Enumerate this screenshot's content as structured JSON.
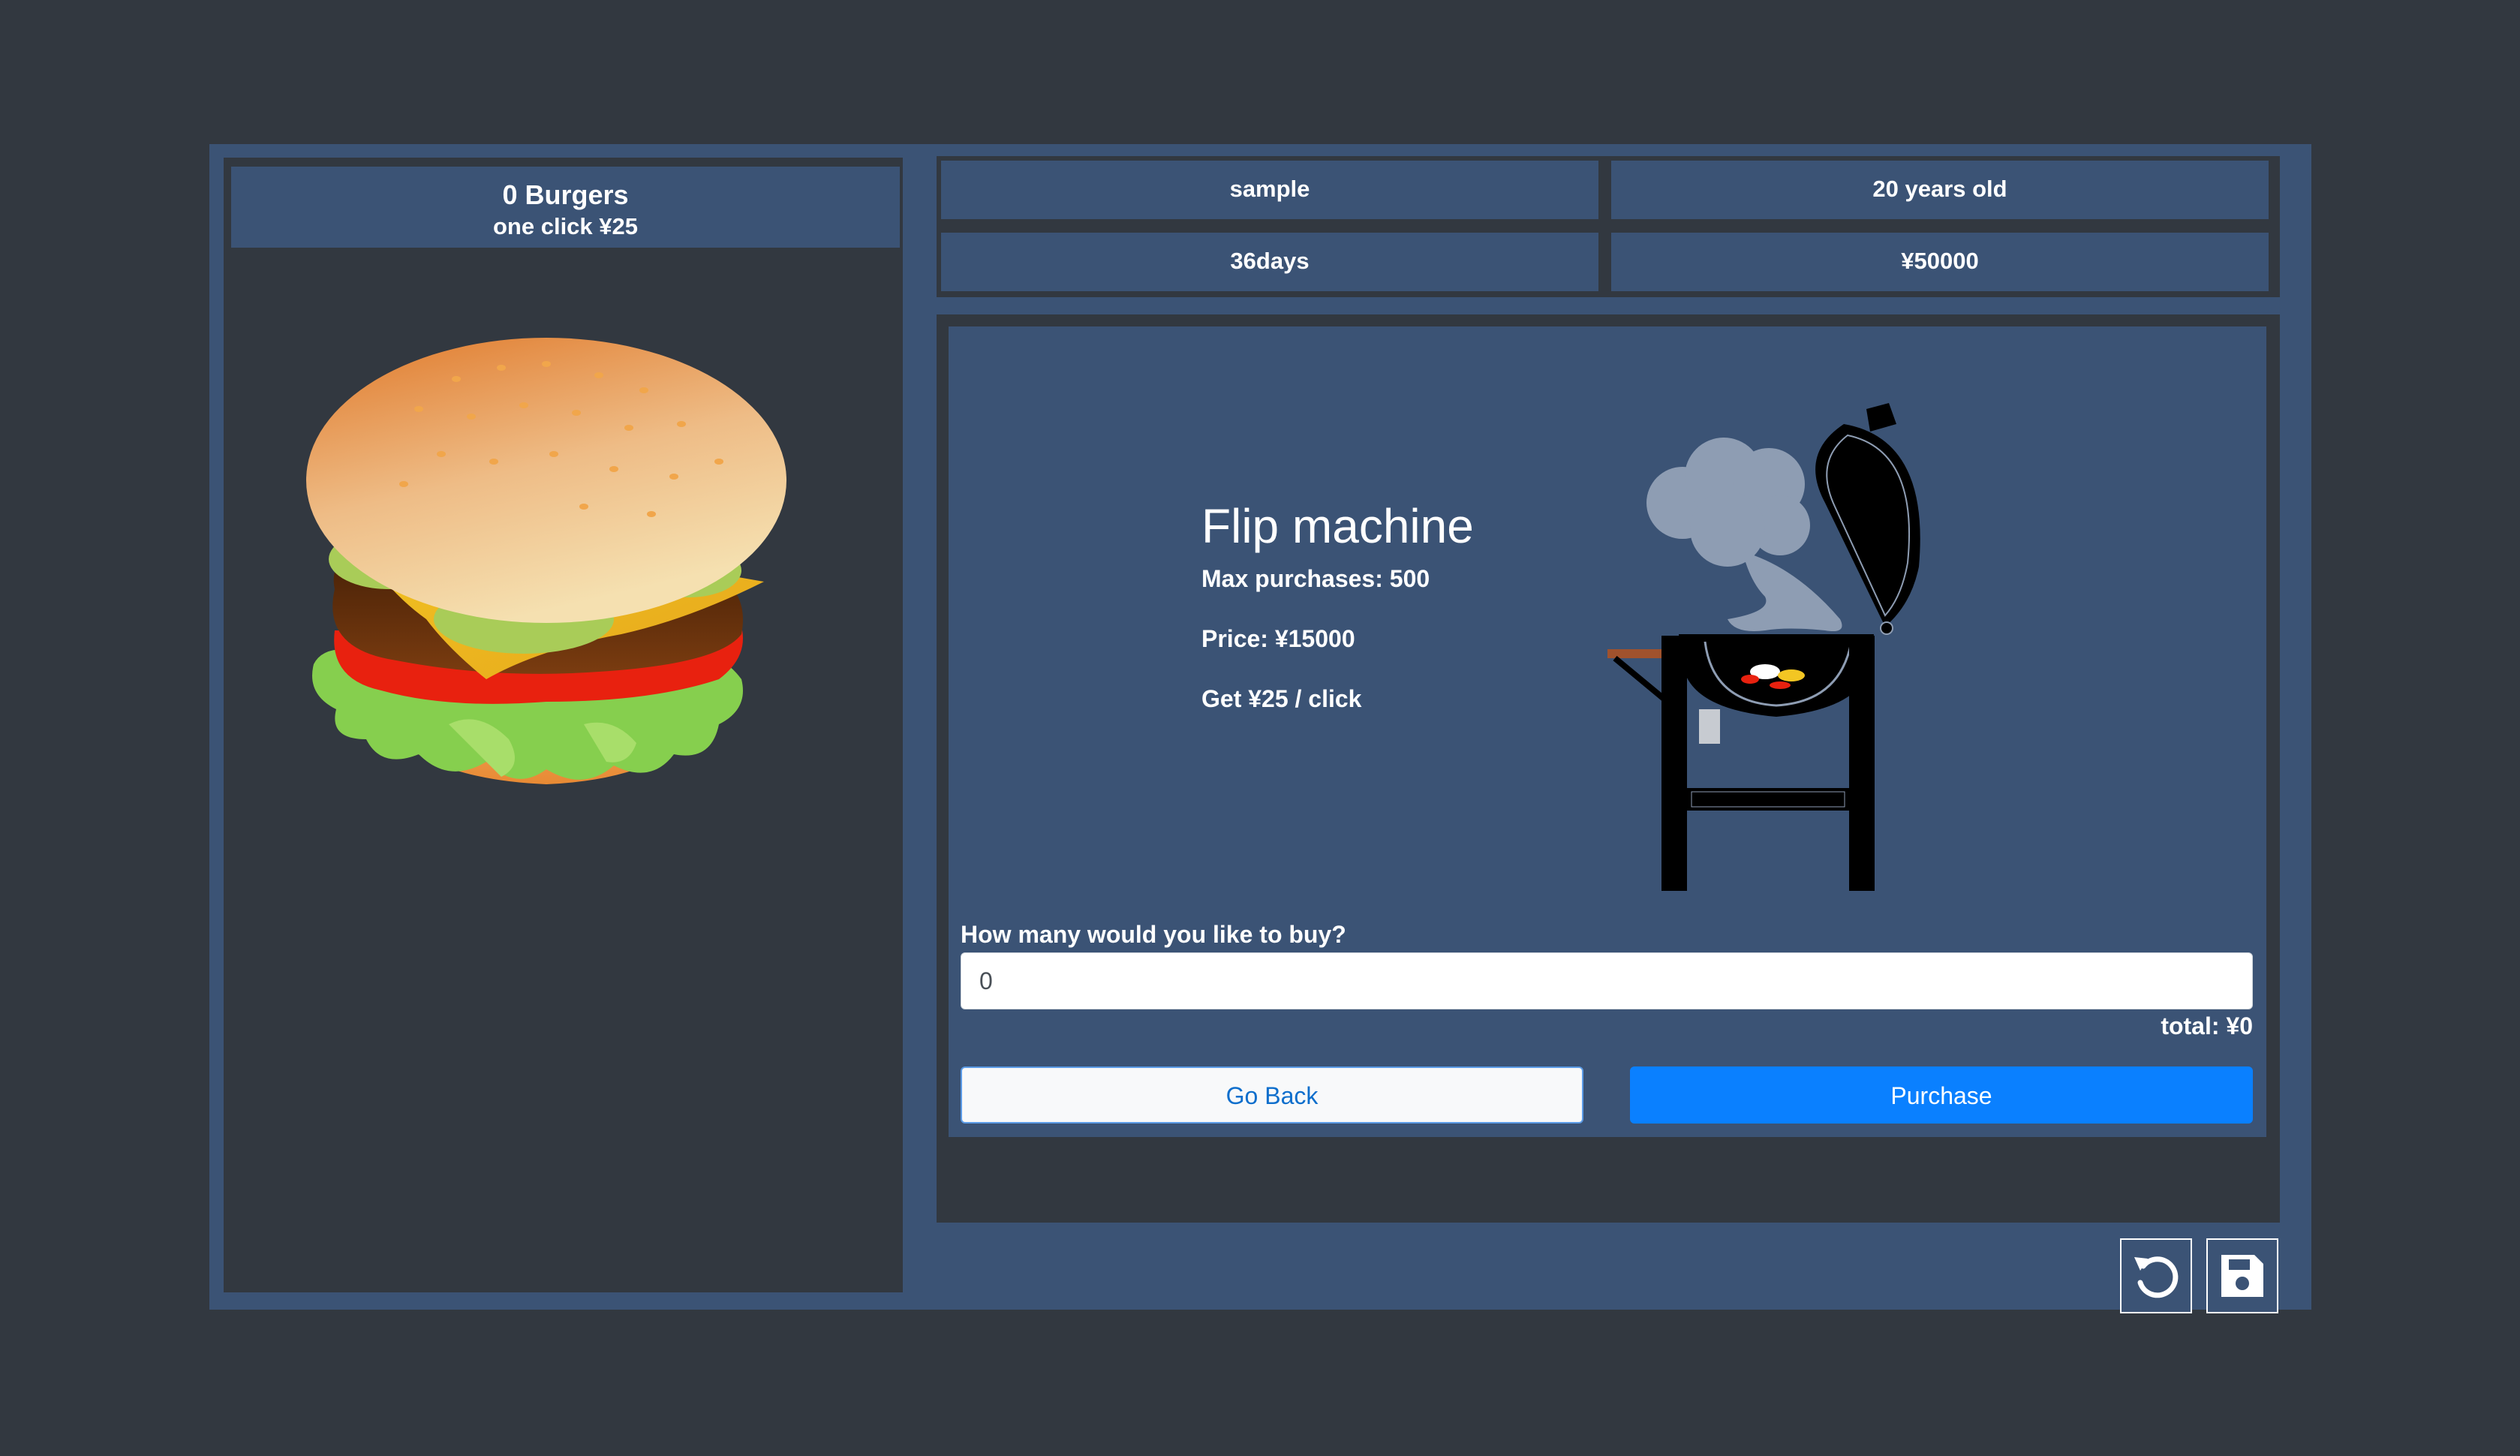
{
  "burger_panel": {
    "count_label": "0 Burgers",
    "click_value_label": "one click ¥25"
  },
  "player": {
    "name": "sample",
    "age": "20 years old",
    "days": "36days",
    "money": "¥50000"
  },
  "item": {
    "name": "Flip machine",
    "max_purchases": "Max purchases: 500",
    "price": "Price: ¥15000",
    "effect": "Get ¥25 / click"
  },
  "purchase_form": {
    "question": "How many would you like to buy?",
    "quantity_value": "0",
    "total": "total: ¥0",
    "back_label": "Go Back",
    "purchase_label": "Purchase"
  },
  "icons": {
    "reset": "reset-icon",
    "save": "save-icon"
  }
}
